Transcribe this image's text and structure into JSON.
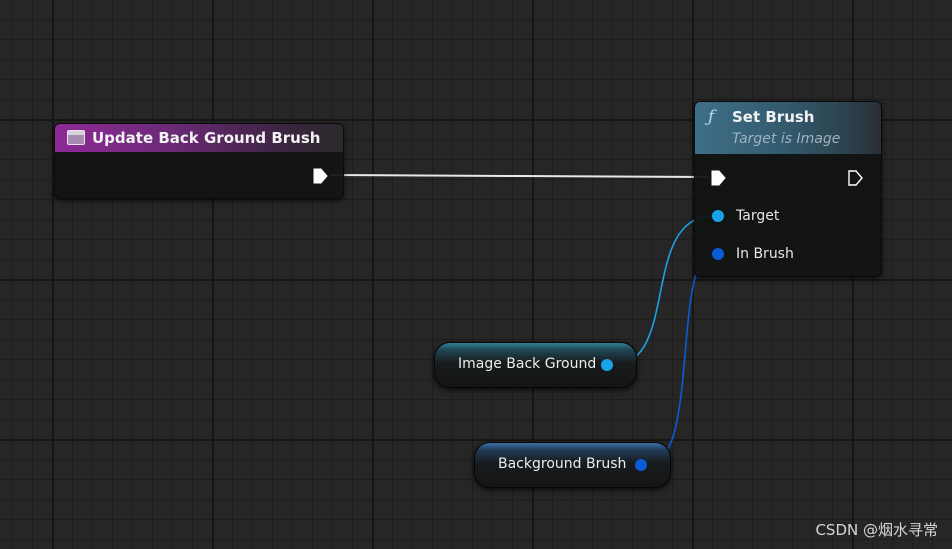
{
  "event_node": {
    "title": "Update Back Ground Brush",
    "header_color": "#8e2a98"
  },
  "function_node": {
    "icon": "function-icon",
    "icon_glyph": "ƒ",
    "title": "Set Brush",
    "subtitle": "Target is Image",
    "header_color": "#3f6f88",
    "pins": {
      "target_label": "Target",
      "in_brush_label": "In Brush"
    }
  },
  "variables": {
    "image": {
      "label": "Image Back Ground",
      "pin_color": "#1aa3e8"
    },
    "brush": {
      "label": "Background Brush",
      "pin_color": "#0a5bd6"
    }
  },
  "colors": {
    "exec_wire": "#e8e8e8",
    "object_wire": "#1aa3e8",
    "struct_wire": "#0a5bd6"
  },
  "watermark": "CSDN @烟水寻常"
}
